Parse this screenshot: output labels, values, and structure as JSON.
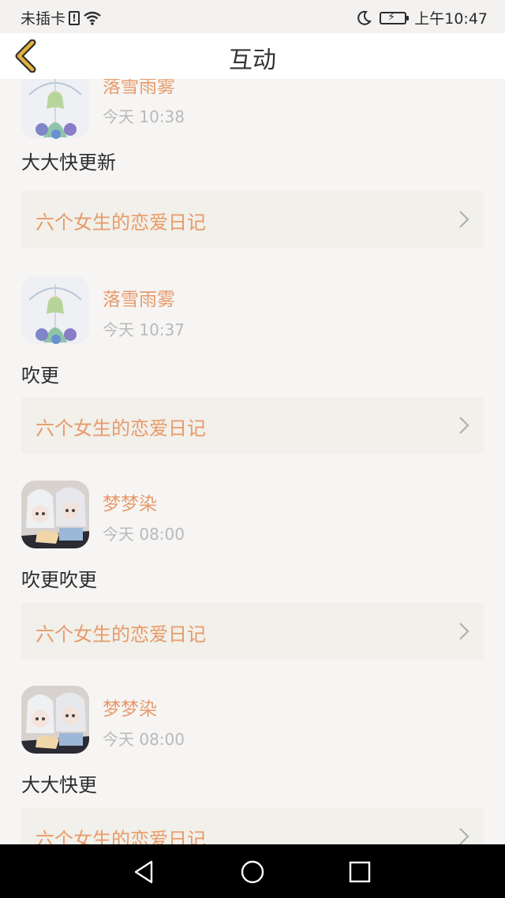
{
  "status_bar": {
    "carrier": "未插卡",
    "time": "上午10:47",
    "icons": [
      "sim-warning-icon",
      "wifi-icon",
      "moon-icon",
      "battery-charging-icon"
    ]
  },
  "header": {
    "title": "互动",
    "back_icon": "chevron-left-icon"
  },
  "items": [
    {
      "username": "落雪雨雾",
      "time": "今天 10:38",
      "comment": "大大快更新",
      "book": "六个女生的恋爱日记",
      "avatar": "girl-umbrella"
    },
    {
      "username": "落雪雨雾",
      "time": "今天 10:37",
      "comment": "吹更",
      "book": "六个女生的恋爱日记",
      "avatar": "girl-umbrella"
    },
    {
      "username": "梦梦染",
      "time": "今天 08:00",
      "comment": "吹更吹更",
      "book": "六个女生的恋爱日记",
      "avatar": "anime-couple"
    },
    {
      "username": "梦梦染",
      "time": "今天 08:00",
      "comment": "大大快更",
      "book": "六个女生的恋爱日记",
      "avatar": "anime-couple"
    }
  ],
  "nav_bar": {
    "icons": [
      "back-triangle-icon",
      "home-circle-icon",
      "recents-square-icon"
    ]
  },
  "colors": {
    "accent": "#e89a6a",
    "back_icon": "#e0b33a",
    "timestamp": "#b9b9b9",
    "card_bg": "#f1f0ea",
    "page_bg": "#f6f5f4"
  }
}
